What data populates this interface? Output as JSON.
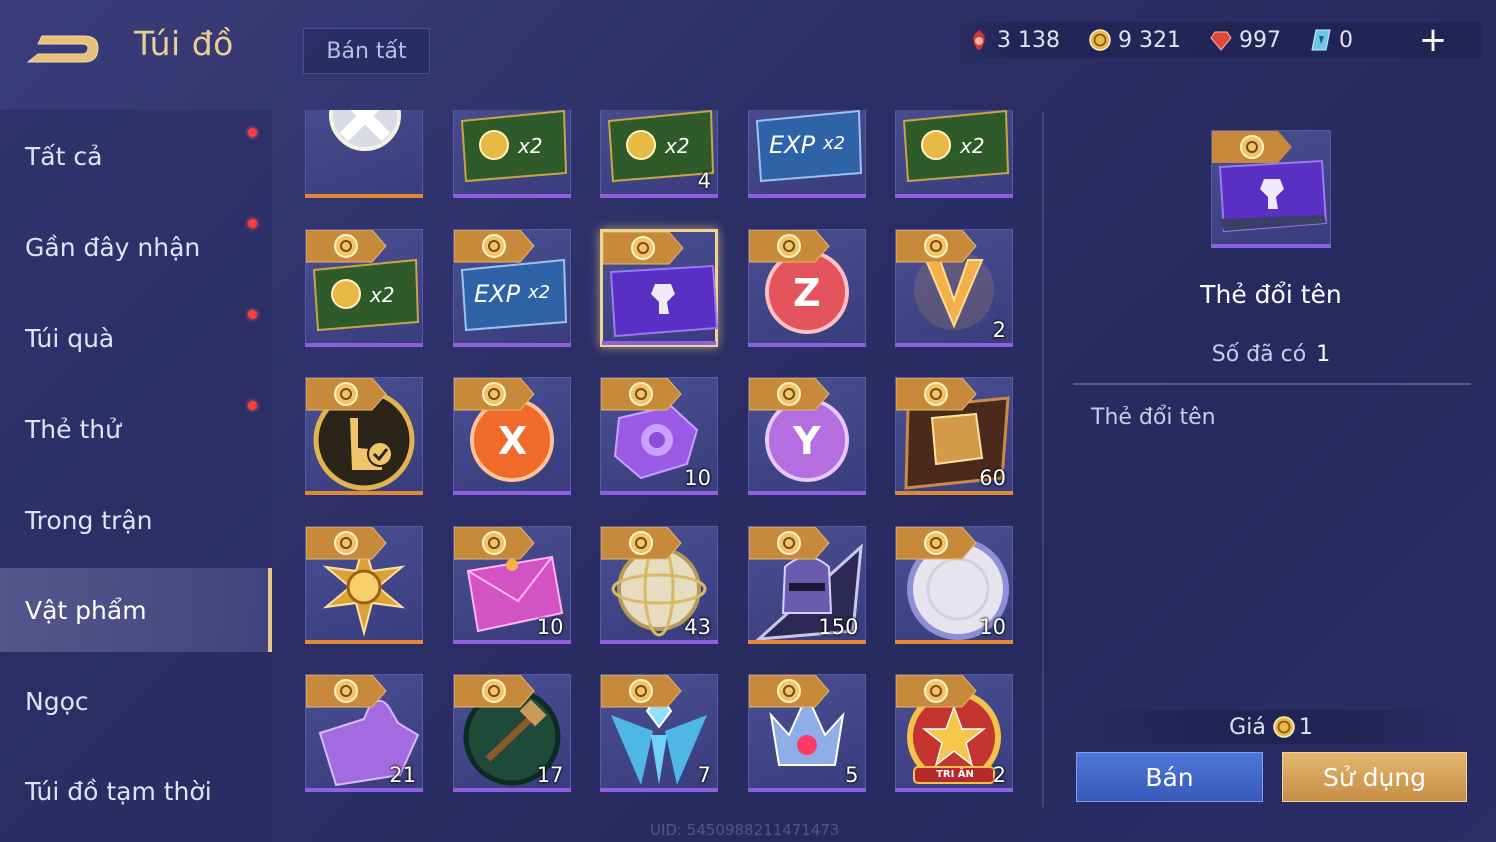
{
  "header": {
    "title": "Túi đồ",
    "sell_all_label": "Bán tất",
    "currencies": [
      {
        "icon": "red-voucher-icon",
        "value": "3 138"
      },
      {
        "icon": "gold-coin-icon",
        "value": "9 321"
      },
      {
        "icon": "ruby-icon",
        "value": "997"
      },
      {
        "icon": "blue-ticket-icon",
        "value": "0"
      }
    ],
    "add_label": "+"
  },
  "sidebar": {
    "items": [
      {
        "label": "Tất cả",
        "dot": true
      },
      {
        "label": "Gần đây nhận",
        "dot": true
      },
      {
        "label": "Túi quà",
        "dot": true
      },
      {
        "label": "Thẻ thử",
        "dot": true
      },
      {
        "label": "Trong trận",
        "dot": false
      },
      {
        "label": "Vật phẩm",
        "dot": false,
        "active": true
      },
      {
        "label": "Ngọc",
        "dot": false
      },
      {
        "label": "Túi đồ tạm thời",
        "dot": false
      }
    ]
  },
  "grid": {
    "items": [
      {
        "icon": "silver-x-emblem-icon",
        "count": "",
        "bar": "orange"
      },
      {
        "icon": "gold-x2-card-icon",
        "count": "",
        "bar": "purple"
      },
      {
        "icon": "gold-x2-card-icon",
        "count": "4",
        "bar": "purple"
      },
      {
        "icon": "exp-x2-card-icon",
        "count": "",
        "bar": "purple"
      },
      {
        "icon": "gold-x2-card-icon",
        "count": "",
        "bar": "purple"
      },
      {
        "icon": "gold-x2-card-icon",
        "count": "",
        "bar": "purple"
      },
      {
        "icon": "exp-x2-card-icon",
        "count": "",
        "bar": "purple"
      },
      {
        "icon": "rename-card-icon",
        "count": "",
        "bar": "purple",
        "selected": true
      },
      {
        "icon": "z-coin-icon",
        "count": "",
        "bar": "purple"
      },
      {
        "icon": "v-emblem-icon",
        "count": "2",
        "bar": "purple"
      },
      {
        "icon": "tap-check-icon",
        "count": "",
        "bar": "orange"
      },
      {
        "icon": "x-coin-icon",
        "count": "",
        "bar": "purple"
      },
      {
        "icon": "purple-rose-puzzle-icon",
        "count": "10",
        "bar": "purple"
      },
      {
        "icon": "y-coin-icon",
        "count": "",
        "bar": "purple"
      },
      {
        "icon": "armor-chest-icon",
        "count": "60",
        "bar": "orange"
      },
      {
        "icon": "sun-emblem-icon",
        "count": "",
        "bar": "orange"
      },
      {
        "icon": "pink-envelope-icon",
        "count": "10",
        "bar": "purple"
      },
      {
        "icon": "astrolabe-orb-icon",
        "count": "43",
        "bar": "purple"
      },
      {
        "icon": "knight-helmet-icon",
        "count": "150",
        "bar": "orange"
      },
      {
        "icon": "white-medallion-icon",
        "count": "10",
        "bar": "orange"
      },
      {
        "icon": "purple-puzzle-piece-icon",
        "count": "21",
        "bar": "purple"
      },
      {
        "icon": "hammer-coin-icon",
        "count": "17",
        "bar": "purple"
      },
      {
        "icon": "blue-crystal-wings-icon",
        "count": "7",
        "bar": "purple"
      },
      {
        "icon": "crystal-crown-icon",
        "count": "5",
        "bar": "purple"
      },
      {
        "icon": "tri-an-star-badge-icon",
        "count": "2",
        "bar": "purple",
        "badge_text": "TRI ÂN"
      }
    ]
  },
  "detail": {
    "name": "Thẻ đổi tên",
    "owned_label": "Số đã có",
    "owned_value": "1",
    "description": "Thẻ đổi tên",
    "price_label": "Giá",
    "price_value": "1",
    "sell_label": "Bán",
    "use_label": "Sử dụng"
  },
  "footer": {
    "uid": "UID: 5450988211471473"
  },
  "colors": {
    "accent_gold": "#e9cf93",
    "rarity_purple": "#8e5fe0",
    "rarity_orange": "#e08a35",
    "notification_red": "#ff3b3b",
    "button_blue": "#3f66c8",
    "button_gold": "#d6a25a"
  }
}
